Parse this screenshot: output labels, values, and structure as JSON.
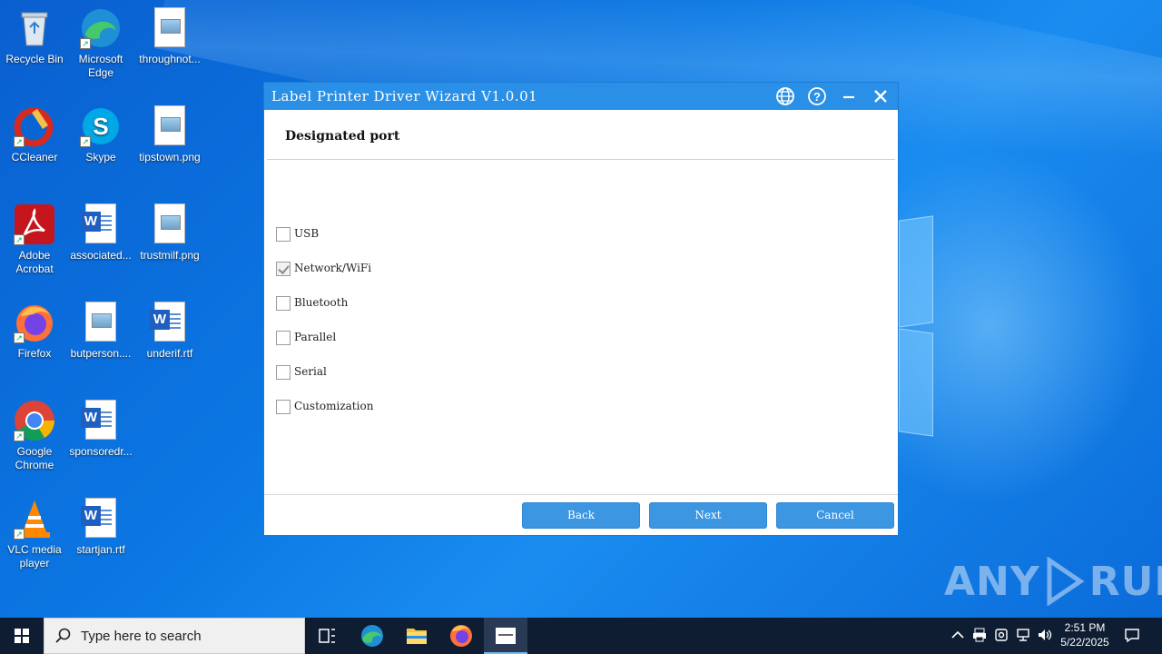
{
  "desktop": {
    "icons": [
      {
        "label": "Recycle Bin"
      },
      {
        "label": "Microsoft Edge"
      },
      {
        "label": "throughnot..."
      },
      {
        "label": "CCleaner"
      },
      {
        "label": "Skype"
      },
      {
        "label": "tipstown.png"
      },
      {
        "label": "Adobe Acrobat"
      },
      {
        "label": "associated..."
      },
      {
        "label": "trustmilf.png"
      },
      {
        "label": "Firefox"
      },
      {
        "label": "butperson...."
      },
      {
        "label": "underif.rtf"
      },
      {
        "label": "Google Chrome"
      },
      {
        "label": "sponsoredr..."
      },
      {
        "label": "VLC media player"
      },
      {
        "label": "startjan.rtf"
      }
    ]
  },
  "dialog": {
    "title": "Label Printer Driver Wizard  V1.0.01",
    "heading": "Designated port",
    "options": [
      {
        "label": "USB",
        "checked": false
      },
      {
        "label": "Network/WiFi",
        "checked": true
      },
      {
        "label": "Bluetooth",
        "checked": false
      },
      {
        "label": "Parallel",
        "checked": false
      },
      {
        "label": "Serial",
        "checked": false
      },
      {
        "label": "Customization",
        "checked": false
      }
    ],
    "buttons": {
      "back": "Back",
      "next": "Next",
      "cancel": "Cancel"
    }
  },
  "watermark": {
    "left": "ANY",
    "right": "RUN"
  },
  "taskbar": {
    "search_placeholder": "Type here to search",
    "clock_time": "2:51 PM",
    "clock_date": "5/22/2025"
  }
}
